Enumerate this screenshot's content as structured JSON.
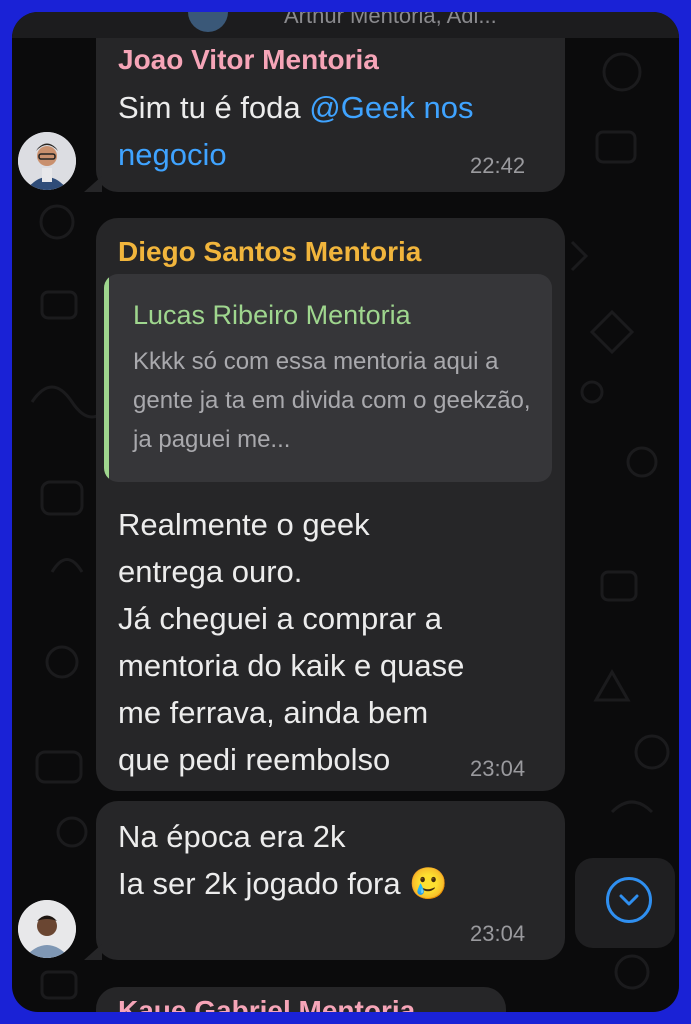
{
  "header": {
    "title": "Arthur Mentoria, Adi..."
  },
  "messages": [
    {
      "sender": "Joao Vitor Mentoria",
      "sender_color": "#f6a5b8",
      "text_plain": "Sim tu é foda ",
      "mention": "@Geek nos negocio",
      "time": "22:42"
    },
    {
      "sender": "Diego Santos Mentoria",
      "sender_color": "#f1b53c",
      "quote": {
        "name": "Lucas Ribeiro Mentoria",
        "text": "Kkkk só com essa mentoria aqui a gente ja ta em divida com o geekzão, ja paguei me..."
      },
      "lines": [
        "Realmente o geek",
        "entrega ouro.",
        "Já cheguei a comprar a",
        "mentoria do kaik e quase",
        "me ferrava, ainda bem",
        "que pedi reembolso"
      ],
      "time": "23:04"
    },
    {
      "lines": [
        "Na época era 2k",
        "Ia ser 2k jogado fora 🥲"
      ],
      "time": "23:04"
    },
    {
      "sender": "Kaue Gabriel Mentoria",
      "sender_color": "#f6a5b8"
    }
  ],
  "icons": {
    "scroll_down": "chevron-down-icon"
  },
  "colors": {
    "bubble": "#262628",
    "background": "#0b0b0c",
    "accent": "#2f8ff0",
    "mention": "#3fa3ff"
  }
}
